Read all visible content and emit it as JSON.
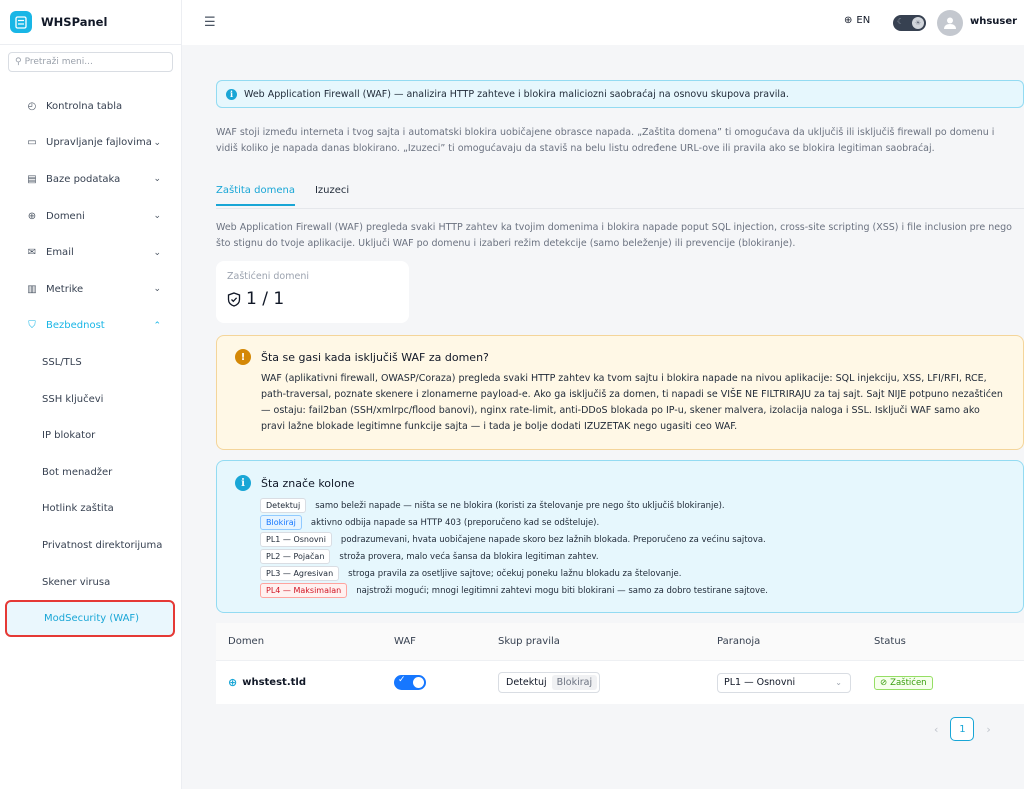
{
  "app": {
    "name": "WHSPanel"
  },
  "search": {
    "placeholder": "Pretraži meni..."
  },
  "sidebar": {
    "items": [
      {
        "label": "Kontrolna tabla",
        "icon": "dashboard-icon"
      },
      {
        "label": "Upravljanje fajlovima",
        "icon": "folder-icon"
      },
      {
        "label": "Baze podataka",
        "icon": "database-icon"
      },
      {
        "label": "Domeni",
        "icon": "globe-icon"
      },
      {
        "label": "Email",
        "icon": "mail-icon"
      },
      {
        "label": "Metrike",
        "icon": "chart-icon"
      },
      {
        "label": "Bezbednost",
        "icon": "shield-icon"
      }
    ],
    "security_sub": [
      "SSL/TLS",
      "SSH ključevi",
      "IP blokator",
      "Bot menadžer",
      "Hotlink zaštita",
      "Privatnost direktorijuma",
      "Skener virusa",
      "ModSecurity (WAF)"
    ]
  },
  "topbar": {
    "language": "EN",
    "username": "whsuser"
  },
  "banner": {
    "text": "Web Application Firewall (WAF) — analizira HTTP zahteve i blokira maliciozni saobraćaj na osnovu skupova pravila."
  },
  "intro": {
    "text": "WAF stoji između interneta i tvog sajta i automatski blokira uobičajene obrasce napada. „Zaštita domena” ti omogućava da uključiš ili isključiš firewall po domenu i vidiš koliko je napada danas blokirano. „Izuzeci” ti omogućavaju da staviš na belu listu određene URL-ove ili pravila ako se blokira legitiman saobraćaj."
  },
  "tabs": {
    "protection": "Zaštita domena",
    "exceptions": "Izuzeci"
  },
  "description": {
    "text": "Web Application Firewall (WAF) pregleda svaki HTTP zahtev ka tvojim domenima i blokira napade poput SQL injection, cross-site scripting (XSS) i file inclusion pre nego što stignu do tvoje aplikacije. Uključi WAF po domenu i izaberi režim detekcije (samo beleženje) ili prevencije (blokiranje)."
  },
  "stat": {
    "label": "Zaštićeni domeni",
    "value": "1 / 1"
  },
  "warning": {
    "title": "Šta se gasi kada isključiš WAF za domen?",
    "body": "WAF (aplikativni firewall, OWASP/Coraza) pregleda svaki HTTP zahtev ka tvom sajtu i blokira napade na nivou aplikacije: SQL injekciju, XSS, LFI/RFI, RCE, path-traversal, poznate skenere i zlonamerne payload-e. Ako ga isključiš za domen, ti napadi se VIŠE NE FILTRIRAJU za taj sajt. Sajt NIJE potpuno nezaštićen — ostaju: fail2ban (SSH/xmlrpc/flood banovi), nginx rate-limit, anti-DDoS blokada po IP-u, skener malvera, izolacija naloga i SSL. Isključi WAF samo ako pravi lažne blokade legitimne funkcije sajta — i tada je bolje dodati IZUZETAK nego ugasiti ceo WAF."
  },
  "info": {
    "title": "Šta znače kolone",
    "rows": [
      {
        "tag": "Detektuj",
        "text": "samo beleži napade — ništa se ne blokira (koristi za štelovanje pre nego što uključiš blokiranje)."
      },
      {
        "tag": "Blokiraj",
        "text": "aktivno odbija napade sa HTTP 403 (preporučeno kad se odšteluje)."
      },
      {
        "tag": "PL1 — Osnovni",
        "text": "podrazumevani, hvata uobičajene napade skoro bez lažnih blokada. Preporučeno za većinu sajtova."
      },
      {
        "tag": "PL2 — Pojačan",
        "text": "stroža provera, malo veća šansa da blokira legitiman zahtev."
      },
      {
        "tag": "PL3 — Agresivan",
        "text": "stroga pravila za osetljive sajtove; očekuj poneku lažnu blokadu za štelovanje."
      },
      {
        "tag": "PL4 — Maksimalan",
        "text": "najstroži mogući; mnogi legitimni zahtevi mogu biti blokirani — samo za dobro testirane sajtove."
      }
    ]
  },
  "table": {
    "headers": [
      "Domen",
      "WAF",
      "Skup pravila",
      "Paranoja",
      "Status"
    ],
    "row": {
      "domain": "whstest.tld",
      "waf_enabled": true,
      "ruleset_options": [
        "Detektuj",
        "Blokiraj"
      ],
      "paranoia": "PL1 — Osnovni",
      "status": "Zaštićen"
    }
  },
  "pagination": {
    "current": "1"
  },
  "colors": {
    "accent": "#19a6d6",
    "warning": "#d48806",
    "success": "#389e0d",
    "selection_outline": "#e53935"
  }
}
